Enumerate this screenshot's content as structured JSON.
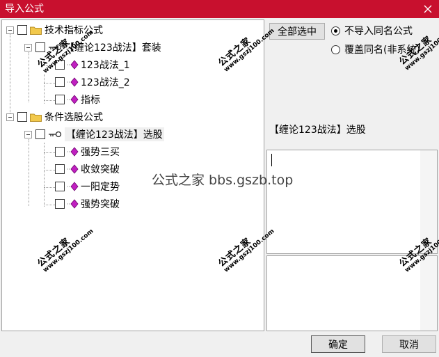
{
  "dialog": {
    "title": "导入公式"
  },
  "tree": {
    "group1": {
      "label": "技术指标公式",
      "child": {
        "label": "【缠论123战法】套装",
        "items": [
          "123战法_1",
          "123战法_2",
          "指标"
        ]
      }
    },
    "group2": {
      "label": "条件选股公式",
      "child": {
        "label": "【缠论123战法】选股",
        "items": [
          "强势三买",
          "收敛突破",
          "一阳定势",
          "强势突破"
        ]
      }
    }
  },
  "right_panel": {
    "select_all_label": "全部选中",
    "radio_skip_label": "不导入同名公式",
    "radio_overwrite_label": "覆盖同名(非系统)",
    "selected_formula": "【缠论123战法】选股"
  },
  "watermark": {
    "center_text": "公式之家 bbs.gszb.top",
    "stamp_line1": "公式之家",
    "stamp_line2": "www.gszj100.com"
  },
  "buttons": {
    "ok_label": "确定",
    "cancel_label": "取消"
  },
  "colors": {
    "titlebar": "#c8102e",
    "diamond": "#c020c0",
    "folder": "#f2c94c"
  }
}
